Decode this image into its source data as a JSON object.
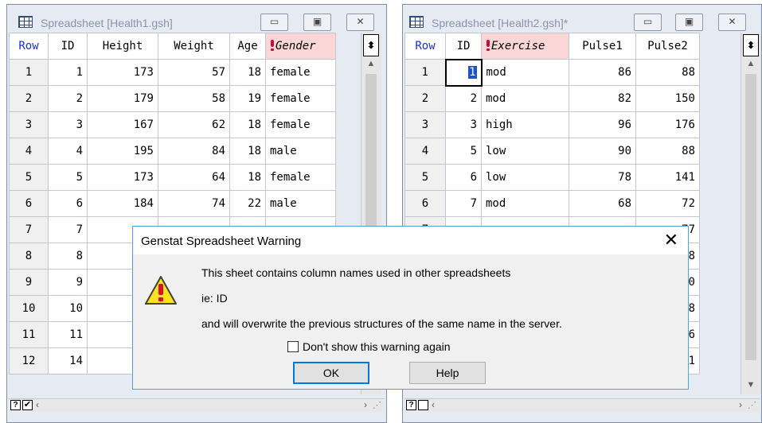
{
  "win1": {
    "title": "Spreadsheet [Health1.gsh]",
    "buttons": {
      "minimize": "▭",
      "maximize": "▣",
      "close": "✕"
    },
    "columns": [
      "Row",
      "ID",
      "Height",
      "Weight",
      "Age",
      "Gender"
    ],
    "rows": [
      [
        "1",
        "1",
        "173",
        "57",
        "18",
        "female"
      ],
      [
        "2",
        "2",
        "179",
        "58",
        "19",
        "female"
      ],
      [
        "3",
        "3",
        "167",
        "62",
        "18",
        "female"
      ],
      [
        "4",
        "4",
        "195",
        "84",
        "18",
        "male"
      ],
      [
        "5",
        "5",
        "173",
        "64",
        "18",
        "female"
      ],
      [
        "6",
        "6",
        "184",
        "74",
        "22",
        "male"
      ],
      [
        "7",
        "7",
        "",
        "",
        "",
        ""
      ],
      [
        "8",
        "8",
        "",
        "",
        "",
        ""
      ],
      [
        "9",
        "9",
        "",
        "",
        "",
        ""
      ],
      [
        "10",
        "10",
        "",
        "",
        "",
        ""
      ],
      [
        "11",
        "11",
        "",
        "",
        "",
        ""
      ],
      [
        "12",
        "14",
        "",
        "",
        "",
        ""
      ]
    ],
    "statusbar": {
      "help": "?",
      "check": "✔"
    }
  },
  "win2": {
    "title": "Spreadsheet [Health2.gsh]*",
    "buttons": {
      "minimize": "▭",
      "maximize": "▣",
      "close": "✕"
    },
    "columns": [
      "Row",
      "ID",
      "Exercise",
      "Pulse1",
      "Pulse2"
    ],
    "rows": [
      [
        "1",
        "1",
        "mod",
        "86",
        "88"
      ],
      [
        "2",
        "2",
        "mod",
        "82",
        "150"
      ],
      [
        "3",
        "3",
        "high",
        "96",
        "176"
      ],
      [
        "4",
        "5",
        "low",
        "90",
        "88"
      ],
      [
        "5",
        "6",
        "low",
        "78",
        "141"
      ],
      [
        "6",
        "7",
        "mod",
        "68",
        "72"
      ],
      [
        "7",
        "",
        "",
        "",
        "77"
      ],
      [
        "8",
        "",
        "",
        "",
        "68"
      ],
      [
        "9",
        "",
        "",
        "",
        "150"
      ],
      [
        "10",
        "",
        "",
        "",
        "88"
      ],
      [
        "11",
        "",
        "",
        "",
        "76"
      ],
      [
        "12",
        "",
        "",
        "",
        "71"
      ]
    ],
    "statusbar": {
      "help": "?",
      "check": ""
    }
  },
  "dialog": {
    "title": "Genstat Spreadsheet Warning",
    "close": "✕",
    "line1": "This sheet contains column names used in other spreadsheets",
    "line2": "ie: ID",
    "line3": "and will overwrite the previous structures of the same name in the server.",
    "checkbox_label": "Don't show this warning again",
    "ok_label": "OK",
    "help_label": "Help"
  },
  "icons": [
    "spreadsheet-icon",
    "warning-icon",
    "factor-icon"
  ],
  "colors": {
    "header_blue": "#1d2fc8",
    "factor_bg": "#fbd6d6",
    "selection": "#1c53c6",
    "dialog_accent": "#0078d7"
  }
}
